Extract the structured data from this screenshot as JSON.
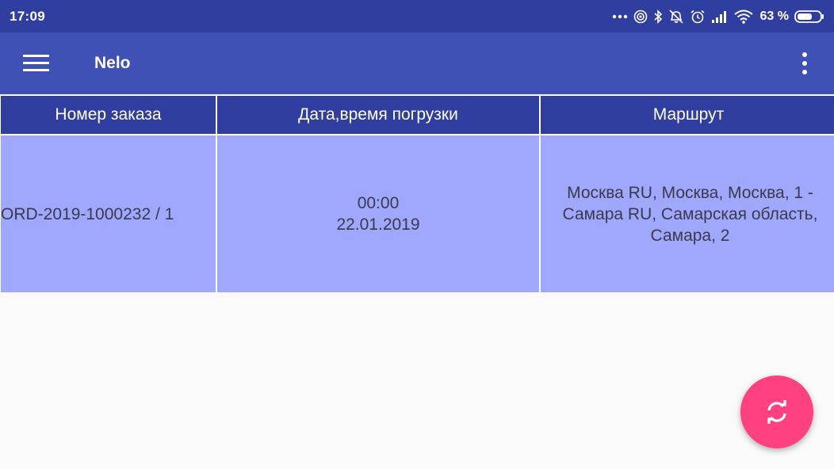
{
  "status_bar": {
    "time": "17:09",
    "battery": "63 %",
    "icons": [
      "more-dots-icon",
      "hotspot-icon",
      "bluetooth-icon",
      "alarm-off-icon",
      "alarm-icon",
      "signal-icon",
      "wifi-icon",
      "battery-icon"
    ]
  },
  "app_bar": {
    "title": "Nelo",
    "menu_icon": "hamburger-menu-icon",
    "overflow_icon": "more-vertical-icon"
  },
  "table": {
    "headers": [
      "Номер заказа",
      "Дата,время погрузки",
      "Маршрут"
    ],
    "rows": [
      {
        "order": "ORD-2019-1000232 / 1",
        "time": "00:00",
        "date": "22.01.2019",
        "route_line1": "Москва RU, Москва, Москва, 1 -",
        "route_line2": "Самара RU, Самарская область,",
        "route_line3": "Самара, 2"
      }
    ]
  },
  "fab": {
    "icon": "refresh-icon"
  },
  "colors": {
    "status_bar": "#303f9f",
    "app_bar": "#3f51b5",
    "header_row": "#303f9f",
    "data_row": "#9fa8fd",
    "fab": "#ff4081",
    "background": "#fafafa"
  }
}
